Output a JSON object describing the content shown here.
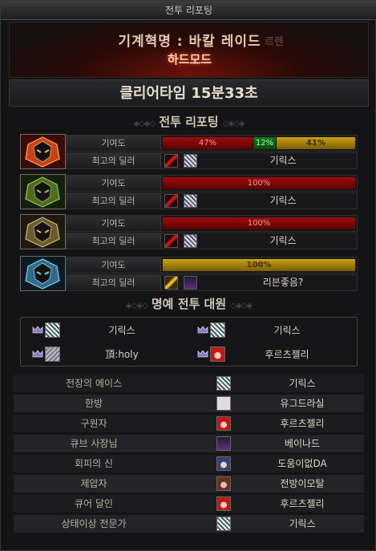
{
  "window": {
    "title": "전투 리포팅"
  },
  "raid": {
    "name": "기계혁명 : 바칼 레이드",
    "ghost_text": "르렌",
    "difficulty": "하드모드"
  },
  "clear_time": "클리어타임  15분33초",
  "sections": {
    "report": "전투 리포팅",
    "honor": "명예 전투 대원"
  },
  "row_labels": {
    "contribution": "기여도",
    "top_dealer": "최고의 딜러"
  },
  "parties": [
    {
      "portrait": "red-mech-portrait",
      "segments": [
        {
          "label": "47%",
          "value": 47,
          "color": "red"
        },
        {
          "label": "12%",
          "value": 12,
          "color": "green"
        },
        {
          "label": "41%",
          "value": 41,
          "color": "gold"
        }
      ],
      "dealer": "기릭스",
      "weapon": "red"
    },
    {
      "portrait": "green-mech-portrait",
      "segments": [
        {
          "label": "100%",
          "value": 100,
          "color": "red"
        }
      ],
      "dealer": "기릭스",
      "weapon": "red"
    },
    {
      "portrait": "gold-mech-portrait",
      "segments": [
        {
          "label": "100%",
          "value": 100,
          "color": "red"
        }
      ],
      "dealer": "기릭스",
      "weapon": "red"
    },
    {
      "portrait": "blue-mech-portrait",
      "segments": [
        {
          "label": "100%",
          "value": 100,
          "color": "gold"
        }
      ],
      "dealer": "리븐좋음?",
      "weapon": "gold"
    }
  ],
  "honor_members": [
    {
      "name": "기릭스"
    },
    {
      "name": "기릭스"
    },
    {
      "name": "頂:holy"
    },
    {
      "name": "후르츠젤리"
    }
  ],
  "titles": [
    {
      "title": "전장의 에이스",
      "player": "기릭스"
    },
    {
      "title": "한방",
      "player": "유그드라실"
    },
    {
      "title": "구원자",
      "player": "후르츠젤리"
    },
    {
      "title": "큐브 사장님",
      "player": "베이나드"
    },
    {
      "title": "회피의 신",
      "player": "도움이없DA"
    },
    {
      "title": "제압자",
      "player": "전방이모탈"
    },
    {
      "title": "큐어 달인",
      "player": "후르츠젤리"
    },
    {
      "title": "상태이상 전문가",
      "player": "기릭스"
    }
  ],
  "colors": {
    "red": "#8a0808",
    "green": "#0d7d1d",
    "gold": "#c9a213",
    "accent_glow": "#ff3a10"
  }
}
